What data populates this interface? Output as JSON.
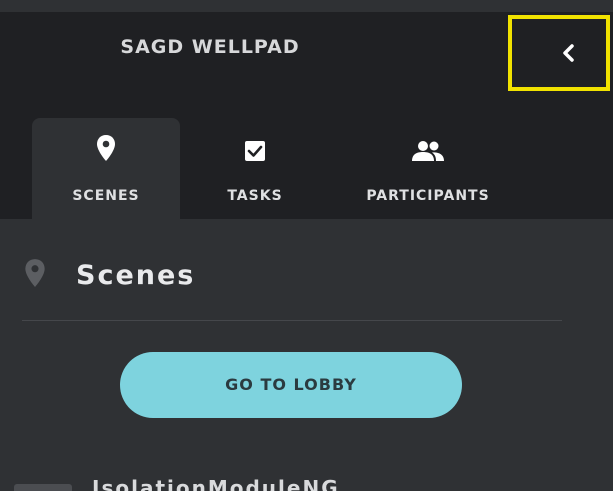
{
  "header": {
    "title": "SAGD WELLPAD",
    "collapse_icon": "chevron-left-icon"
  },
  "tabs": [
    {
      "label": "SCENES",
      "icon": "map-pin-icon",
      "active": true
    },
    {
      "label": "TASKS",
      "icon": "checkbox-icon",
      "active": false
    },
    {
      "label": "PARTICIPANTS",
      "icon": "people-icon",
      "active": false
    }
  ],
  "section": {
    "title": "Scenes",
    "icon": "map-pin-icon"
  },
  "lobby_button": {
    "label": "GO TO LOBBY"
  },
  "scene_list": [
    {
      "label": "IsolationModuleNG"
    }
  ],
  "colors": {
    "header_bg": "#1f2023",
    "panel_bg": "#2f3134",
    "accent": "#7ed3de",
    "highlight": "#f1e200"
  }
}
